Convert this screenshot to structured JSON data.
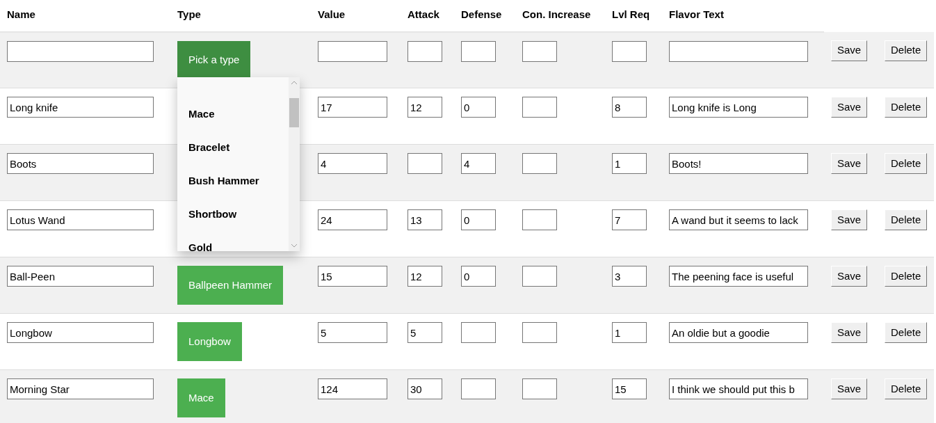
{
  "columns": [
    "Name",
    "Type",
    "Value",
    "Attack",
    "Defense",
    "Con. Increase",
    "Lvl Req",
    "Flavor Text"
  ],
  "rows": [
    {
      "name": "",
      "type": {
        "label": "Pick a type",
        "open": true
      },
      "value": "",
      "attack": "",
      "defense": "",
      "con_increase": "",
      "lvl_req": "",
      "flavor": "",
      "save": "Save",
      "delete": "Delete"
    },
    {
      "name": "Long knife",
      "type": null,
      "value": "17",
      "attack": "12",
      "defense": "0",
      "con_increase": "",
      "lvl_req": "8",
      "flavor": "Long knife is Long",
      "save": "Save",
      "delete": "Delete"
    },
    {
      "name": "Boots",
      "type": null,
      "value": "4",
      "attack": "",
      "defense": "4",
      "con_increase": "",
      "lvl_req": "1",
      "flavor": "Boots!",
      "save": "Save",
      "delete": "Delete"
    },
    {
      "name": "Lotus Wand",
      "type": null,
      "value": "24",
      "attack": "13",
      "defense": "0",
      "con_increase": "",
      "lvl_req": "7",
      "flavor": "A wand but it seems to lack",
      "save": "Save",
      "delete": "Delete"
    },
    {
      "name": "Ball-Peen",
      "type": {
        "label": "Ballpeen Hammer",
        "open": false
      },
      "value": "15",
      "attack": "12",
      "defense": "0",
      "con_increase": "",
      "lvl_req": "3",
      "flavor": "The peening face is useful",
      "save": "Save",
      "delete": "Delete"
    },
    {
      "name": "Longbow",
      "type": {
        "label": "Longbow",
        "open": false
      },
      "value": "5",
      "attack": "5",
      "defense": "",
      "con_increase": "",
      "lvl_req": "1",
      "flavor": "An oldie but a goodie",
      "save": "Save",
      "delete": "Delete"
    },
    {
      "name": "Morning Star",
      "type": {
        "label": "Mace",
        "open": false
      },
      "value": "124",
      "attack": "30",
      "defense": "",
      "con_increase": "",
      "lvl_req": "15",
      "flavor": "I think we should put this b",
      "save": "Save",
      "delete": "Delete"
    }
  ],
  "dropdown": {
    "items": [
      "Mace",
      "Bracelet",
      "Bush Hammer",
      "Shortbow",
      "Gold"
    ]
  }
}
